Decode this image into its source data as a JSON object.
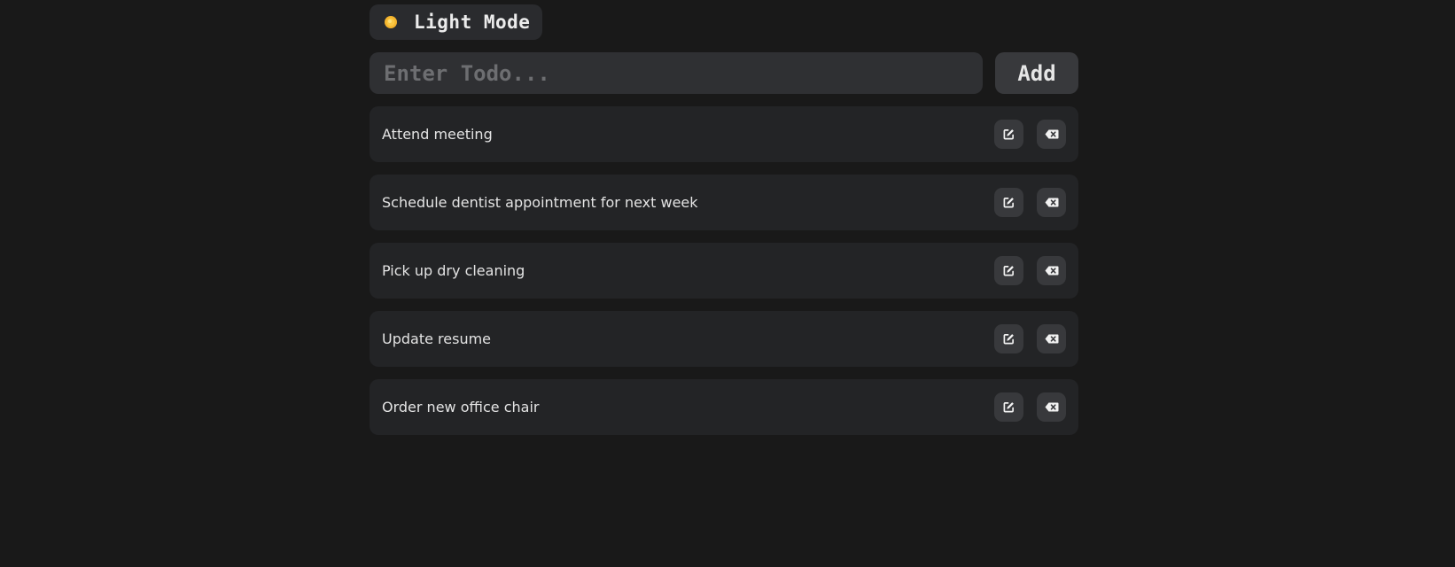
{
  "theme_toggle": {
    "label": "Light Mode",
    "icon": "sun-icon"
  },
  "new_todo": {
    "placeholder": "Enter Todo...",
    "value": "",
    "add_label": "Add"
  },
  "todos": [
    {
      "text": "Attend meeting"
    },
    {
      "text": "Schedule dentist appointment for next week"
    },
    {
      "text": "Pick up dry cleaning"
    },
    {
      "text": "Update resume"
    },
    {
      "text": "Order new office chair"
    }
  ],
  "icons": {
    "edit": "edit-icon",
    "delete": "backspace-icon"
  },
  "colors": {
    "background": "#191919",
    "card": "#232426",
    "button": "#38393c",
    "sun": "#f5b52e"
  }
}
